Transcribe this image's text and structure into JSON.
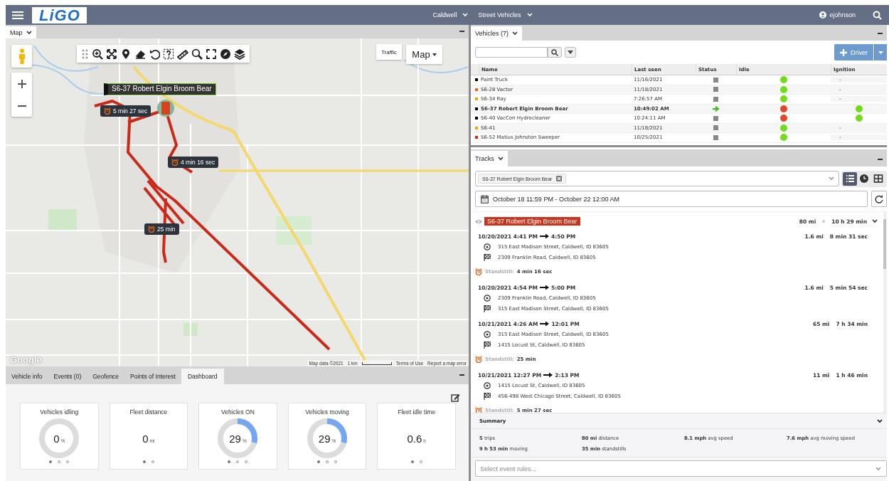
{
  "header": {
    "logo": "LiGO",
    "filters": [
      {
        "label": "Caldwell"
      },
      {
        "label": "Street Vehicles"
      }
    ],
    "user": "ejohnson"
  },
  "map_panel": {
    "title": "Map",
    "traffic_button": "Traffic",
    "map_type": "Map",
    "vehicle_label": "S6-37 Robert Elgin Broom Bear",
    "standstill_markers": [
      "5 min 27 sec",
      "4 min 16 sec",
      "25 min"
    ],
    "attribution": {
      "logo": "Google",
      "items": [
        "Map data ©2021",
        "1 km",
        "Terms of Use",
        "Report a map error"
      ]
    }
  },
  "bottom_tabs": [
    {
      "label": "Vehicle info",
      "selected": false
    },
    {
      "label": "Events (0)",
      "selected": false
    },
    {
      "label": "Geofence",
      "selected": false
    },
    {
      "label": "Points of Interest",
      "selected": false
    },
    {
      "label": "Dashboard",
      "selected": true
    }
  ],
  "dashboard": {
    "tiles": [
      {
        "kind": "donut",
        "title": "Vehicles idling",
        "value": "0",
        "unit": "%",
        "pager": [
          {
            "selected": true
          },
          {
            "selected": false
          },
          {
            "selected": false
          }
        ]
      },
      {
        "kind": "plain",
        "title": "Fleet distance",
        "value": "0",
        "unit": "mi",
        "pager": [
          {
            "selected": true
          },
          {
            "selected": false
          }
        ]
      },
      {
        "kind": "donut",
        "title": "Vehicles ON",
        "value": "29",
        "unit": "%",
        "pager": [
          {
            "selected": true
          },
          {
            "selected": false
          },
          {
            "selected": false
          }
        ]
      },
      {
        "kind": "donut",
        "title": "Vehicles moving",
        "value": "29",
        "unit": "%",
        "pager": [
          {
            "selected": true
          },
          {
            "selected": false
          },
          {
            "selected": false
          }
        ]
      },
      {
        "kind": "plain",
        "title": "Fleet idle time",
        "value": "0.6",
        "unit": "h",
        "pager": [
          {
            "selected": true
          },
          {
            "selected": false
          }
        ]
      }
    ]
  },
  "vehicles": {
    "title": "Vehicles (7)",
    "driver_button": "Driver",
    "columns": [
      "Name",
      "Last seen",
      "Status",
      "Idle",
      "Ignition"
    ],
    "rows": [
      {
        "color": "#000000",
        "name": "Paint Truck",
        "last_seen": "11/16/2021",
        "moving": false,
        "idle": true,
        "ignition_on": false,
        "ignition_text": "-",
        "selected": false
      },
      {
        "color": "#e0691c",
        "name": "S6-28 Vactor",
        "last_seen": "11/18/2021",
        "moving": false,
        "idle": true,
        "ignition_on": false,
        "ignition_text": "-",
        "selected": false
      },
      {
        "color": "#f0a30a",
        "name": "S6-34 Ray",
        "last_seen": "7:26:57 AM",
        "moving": false,
        "idle": true,
        "ignition_on": false,
        "ignition_text": "-",
        "selected": false
      },
      {
        "color": "#000000",
        "name": "S6-37 Robert Elgin Broom Bear",
        "last_seen": "10:49:02 AM",
        "moving": true,
        "idle": false,
        "ignition_on": true,
        "selected": true
      },
      {
        "color": "#000000",
        "name": "S6-40 VacCon Hydrocleaner",
        "last_seen": "10:24:11 AM",
        "moving": false,
        "idle": false,
        "ignition_on": true,
        "selected": false
      },
      {
        "color": "#f0a30a",
        "name": "S6-41",
        "last_seen": "11/18/2021",
        "moving": false,
        "idle": true,
        "ignition_on": false,
        "ignition_text": "-",
        "selected": false
      },
      {
        "color": "#d8281c",
        "name": "S6-52 Matius Johnston Sweeper",
        "last_seen": "10/25/2021",
        "moving": false,
        "idle": true,
        "ignition_on": false,
        "ignition_text": "-",
        "selected": false
      }
    ]
  },
  "tracks": {
    "title": "Tracks",
    "vehicle_chip": "S6-37 Robert Elgin Broom Bear",
    "date_range": "October 18 11:59 PM - October 22 12:00 AM",
    "views": [
      {
        "kind": "list",
        "selected": true
      },
      {
        "kind": "clock",
        "selected": false
      },
      {
        "kind": "table",
        "selected": false
      }
    ],
    "group": {
      "vehicle": "S6-37 Robert Elgin Broom Bear",
      "distance": "80 mi",
      "duration": "10 h 29 min"
    },
    "items": [
      {
        "kind": "trip",
        "start": "10/20/2021 4:41 PM",
        "end": "4:50 PM",
        "distance": "1.6 mi",
        "duration": "8 min 31 sec",
        "from": "315 East Madison Street, Caldwell, ID 83605",
        "to": "2309 Franklin Road, Caldwell, ID 83605"
      },
      {
        "kind": "standstill",
        "label": "Standstill:",
        "duration": "4 min 16 sec"
      },
      {
        "kind": "trip",
        "start": "10/20/2021 4:54 PM",
        "end": "5:00 PM",
        "distance": "1.6 mi",
        "duration": "5 min 54 sec",
        "from": "2309 Franklin Road, Caldwell, ID 83605",
        "to": "315 East Madison Street, Caldwell, ID 83605"
      },
      {
        "kind": "trip",
        "start": "10/21/2021 4:26 AM",
        "end": "12:01 PM",
        "distance": "65 mi",
        "duration": "7 h 34 min",
        "from": "315 East Madison Street, Caldwell, ID 83605",
        "to": "1415 Locust St, Caldwell, ID 83605"
      },
      {
        "kind": "standstill",
        "label": "Standstill:",
        "duration": "25 min"
      },
      {
        "kind": "trip",
        "start": "10/21/2021 12:27 PM",
        "end": "2:13 PM",
        "distance": "11 mi",
        "duration": "1 h 46 min",
        "from": "1415 Locust St, Caldwell, ID 83605",
        "to": "456-498 West Chicago Street, Caldwell, ID 83605"
      },
      {
        "kind": "standstill",
        "label": "Standstill:",
        "duration": "5 min 27 sec"
      }
    ],
    "summary": {
      "title": "Summary",
      "stats": [
        {
          "value": "5",
          "label": "trips"
        },
        {
          "value": "80 mi",
          "label": "distance"
        },
        {
          "value": "8.1 mph",
          "label": "avg speed"
        },
        {
          "value": "7.6 mph",
          "label": "avg moving speed"
        },
        {
          "value": "9 h 53 min",
          "label": "moving"
        },
        {
          "value": "35 min",
          "label": "standstills"
        }
      ]
    },
    "event_rules_placeholder": "Select event rules..."
  }
}
